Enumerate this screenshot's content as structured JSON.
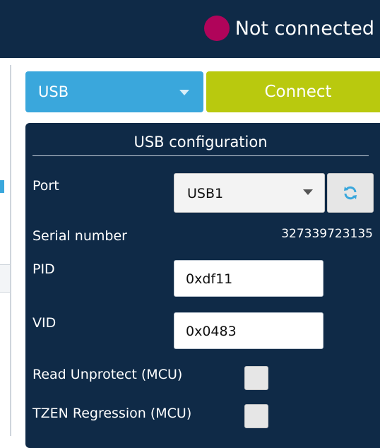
{
  "status": {
    "text": "Not connected",
    "color": "#b0045a"
  },
  "interface_select": {
    "value": "USB"
  },
  "connect_button": {
    "label": "Connect"
  },
  "usb_config": {
    "title": "USB configuration",
    "port": {
      "label": "Port",
      "value": "USB1"
    },
    "refresh_icon": "refresh-icon",
    "serial_number": {
      "label": "Serial number",
      "value": "327339723135"
    },
    "pid": {
      "label": "PID",
      "value": "0xdf11"
    },
    "vid": {
      "label": "VID",
      "value": "0x0483"
    },
    "read_unprotect": {
      "label": "Read Unprotect (MCU)",
      "checked": false
    },
    "tzen_regression": {
      "label": "TZEN Regression (MCU)",
      "checked": false
    }
  },
  "colors": {
    "header_bg": "#0f2a47",
    "panel_bg": "#0f2a47",
    "interface_blue": "#3aa7dc",
    "connect_green": "#b9c90e"
  }
}
